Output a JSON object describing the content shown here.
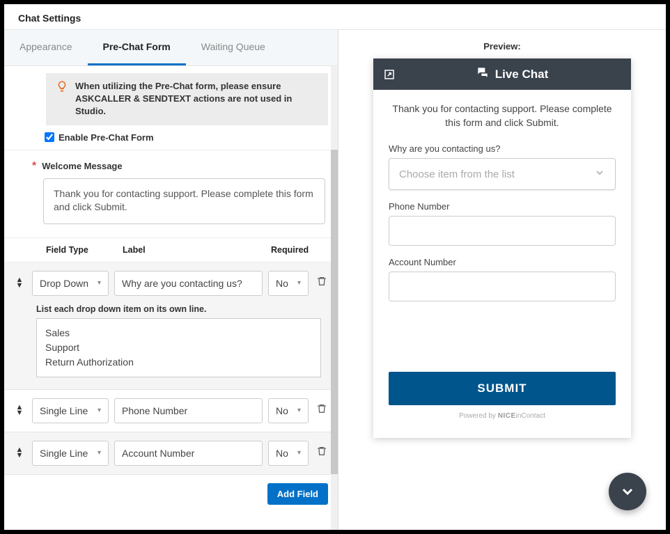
{
  "title": "Chat Settings",
  "tabs": {
    "appearance": "Appearance",
    "prechat": "Pre-Chat Form",
    "waiting": "Waiting Queue"
  },
  "alert": "When utilizing the Pre-Chat form, please ensure ASKCALLER & SENDTEXT actions are not used in Studio.",
  "enable_label": "Enable Pre-Chat Form",
  "welcome_label": "Welcome Message",
  "welcome_text": "Thank you for contacting support. Please complete this form and click Submit.",
  "columns": {
    "type": "Field Type",
    "label": "Label",
    "required": "Required"
  },
  "fields": {
    "opts_hint": "List each drop down item on its own line.",
    "f0": {
      "type": "Drop Down",
      "label": "Why are you contacting us?",
      "required": "No",
      "opts": "Sales\nSupport\nReturn Authorization"
    },
    "f1": {
      "type": "Single Line",
      "label": "Phone Number",
      "required": "No"
    },
    "f2": {
      "type": "Single Line",
      "label": "Account Number",
      "required": "No"
    }
  },
  "add_field": "Add Field",
  "preview": {
    "label": "Preview:",
    "title": "Live Chat",
    "select_placeholder": "Choose item from the list",
    "q0": "Why are you contacting us?",
    "q1": "Phone Number",
    "q2": "Account Number",
    "submit": "SUBMIT",
    "powered_prefix": "Powered by ",
    "powered_brand": "NICE",
    "powered_suffix": "inContact"
  }
}
